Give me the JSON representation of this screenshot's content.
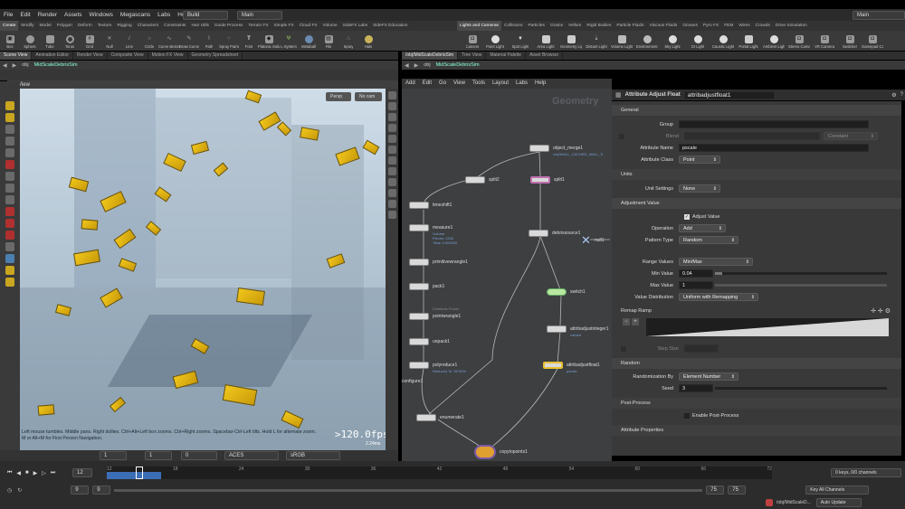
{
  "menu": {
    "items": [
      "File",
      "Edit",
      "Render",
      "Assets",
      "Windows",
      "Megascans",
      "Labs",
      "Help"
    ],
    "desktop_left": "Build",
    "desktop_center": "Main",
    "desktop_right": "Main"
  },
  "shelf_tabs_left": [
    "Create",
    "Modify",
    "Model",
    "Polygon",
    "Deform",
    "Texture",
    "Rigging",
    "Characters",
    "Constraints",
    "Hair Utils",
    "Guide Process",
    "Terrain FX",
    "Simple FX",
    "Cloud FX",
    "Volume",
    "SideFX Labs",
    "SideFX Education"
  ],
  "shelf_tabs_right": [
    "Lights and Cameras",
    "Collisions",
    "Particles",
    "Grains",
    "Vellum",
    "Rigid Bodies",
    "Particle Fluids",
    "Viscous Fluids",
    "Oceans",
    "Pyro FX",
    "FEM",
    "Wires",
    "Crowds",
    "Drive Simulation"
  ],
  "shelf_tools_left": [
    "Box",
    "Sphere",
    "Tube",
    "Torus",
    "Grid",
    "Null",
    "Line",
    "Circle",
    "Curve Bezier",
    "Draw Curve",
    "Path",
    "Spray Paint",
    "Font",
    "Platonic Solids",
    "L-System",
    "Metaball",
    "File",
    "Spray",
    "Halo"
  ],
  "shelf_tools_right": [
    "Camera",
    "Point Light",
    "Spot Light",
    "Area Light",
    "Geometry Light",
    "Distant Light",
    "Volume Light",
    "Environment Light",
    "Sky Light",
    "GI Light",
    "Caustic Light",
    "Portal Light",
    "Ambient Light",
    "Stereo Camera",
    "VR Camera",
    "Switcher",
    "Gamepad Ca"
  ],
  "left_pane": {
    "tabs": [
      "Scene View",
      "Animation Editor",
      "Render View",
      "Composite View",
      "Motion FX View",
      "Geometry Spreadsheet"
    ],
    "path": [
      "obj",
      "MidScaleDebrisSim"
    ],
    "view_label": "View",
    "persp": "Persp",
    "cam": "No cam",
    "hint": "Left mouse tumbles. Middle pans. Right dollies. Ctrl+Alt+Left box zooms. Ctrl+Right zooms. Spacebar-Ctrl-Left tilts. Hold L for alternate zoom.   M or Alt+M for First Person Navigation.",
    "fps": ">120.0fps",
    "ms": "2.24ms",
    "frame_fields": [
      "1",
      "1",
      "0"
    ],
    "ocio_view": "ACES",
    "ocio_space": "sRGB"
  },
  "net_pane": {
    "tabs": [
      "/obj/MidScaleDebrisSim",
      "Tree View",
      "Material Palette",
      "Asset Browser"
    ],
    "path": [
      "obj",
      "MidScaleDebrisSim"
    ],
    "menu": [
      "Add",
      "Edit",
      "Go",
      "View",
      "Tools",
      "Layout",
      "Labs",
      "Help"
    ],
    "context_label": "Geometry",
    "nodes": [
      {
        "name": "object_merge1",
        "sub": "/obj/WALL_CACHED_WALL_S"
      },
      {
        "name": "split2",
        "sub": ""
      },
      {
        "name": "split1",
        "sub": ""
      },
      {
        "name": "timeshift1",
        "sub": ""
      },
      {
        "name": "measure1",
        "sub": "Volume\nPieces: 2343\nTotal: 0.000000"
      },
      {
        "name": "debrissource1",
        "sub": ""
      },
      {
        "name": "null1",
        "sub": ""
      },
      {
        "name": "primitivewrangle1",
        "sub": ""
      },
      {
        "name": "pack1",
        "sub": ""
      },
      {
        "name": "switch1",
        "sub": ""
      },
      {
        "name": "pointwrangle1",
        "sub": "Distribute Points"
      },
      {
        "name": "attribadjustinteger1",
        "sub": "variant"
      },
      {
        "name": "unpack1",
        "sub": ""
      },
      {
        "name": "polyreduce1",
        "sub": "Reduced To: 50.00%"
      },
      {
        "name": "attribadjustfloat1",
        "sub": "pscale"
      },
      {
        "name": "configure1",
        "sub": ""
      },
      {
        "name": "enumerate1",
        "sub": ""
      },
      {
        "name": "copytopoints1",
        "sub": ""
      }
    ]
  },
  "parm_pane": {
    "node_type": "Attribute Adjust Float",
    "node_name": "attribadjustfloat1",
    "general_label": "General",
    "group_label": "Group",
    "blend_label": "Blend",
    "blend_value": "Constant",
    "attr_name_label": "Attribute Name",
    "attr_name": "pscale",
    "attr_class_label": "Attribute Class",
    "attr_class": "Point",
    "units_label": "Units",
    "unit_settings_label": "Unit Settings",
    "unit_settings": "None",
    "adjustment_label": "Adjustment Value",
    "adjust_value_label": "Adjust Value",
    "operation_label": "Operation",
    "operation": "Add",
    "pattern_type_label": "Pattern Type",
    "pattern_type": "Random",
    "range_values_label": "Range Values",
    "range_values": "Min/Max",
    "min_label": "Min Value",
    "min_value": "0.04",
    "max_label": "Max Value",
    "max_value": "1",
    "min_fill": 0.04,
    "max_fill": 1.0,
    "distribution_label": "Value Distribution",
    "distribution": "Uniform with Remapping",
    "remap_label": "Remap Ramp",
    "step_size_label": "Step Size",
    "random_label": "Random",
    "randomization_label": "Randomization By",
    "randomization": "Element Number",
    "seed_label": "Seed",
    "seed": "3",
    "postprocess_label": "Post-Process",
    "enable_pp_label": "Enable Post-Process",
    "attr_props_label": "Attribute Properties"
  },
  "timeline": {
    "start": "1",
    "end": "75",
    "current": "12",
    "field_a": "9",
    "field_b": "9",
    "end_a": "75",
    "end_b": "75",
    "keys": "0 keys, 0/0 channels",
    "key_all": "Key All Channels",
    "auto_update": "Auto Update",
    "status_path": "/obj/MidScaleD...",
    "ticks": [
      "12",
      "18",
      "24",
      "30",
      "36",
      "42",
      "48",
      "54",
      "60",
      "66",
      "72"
    ]
  }
}
